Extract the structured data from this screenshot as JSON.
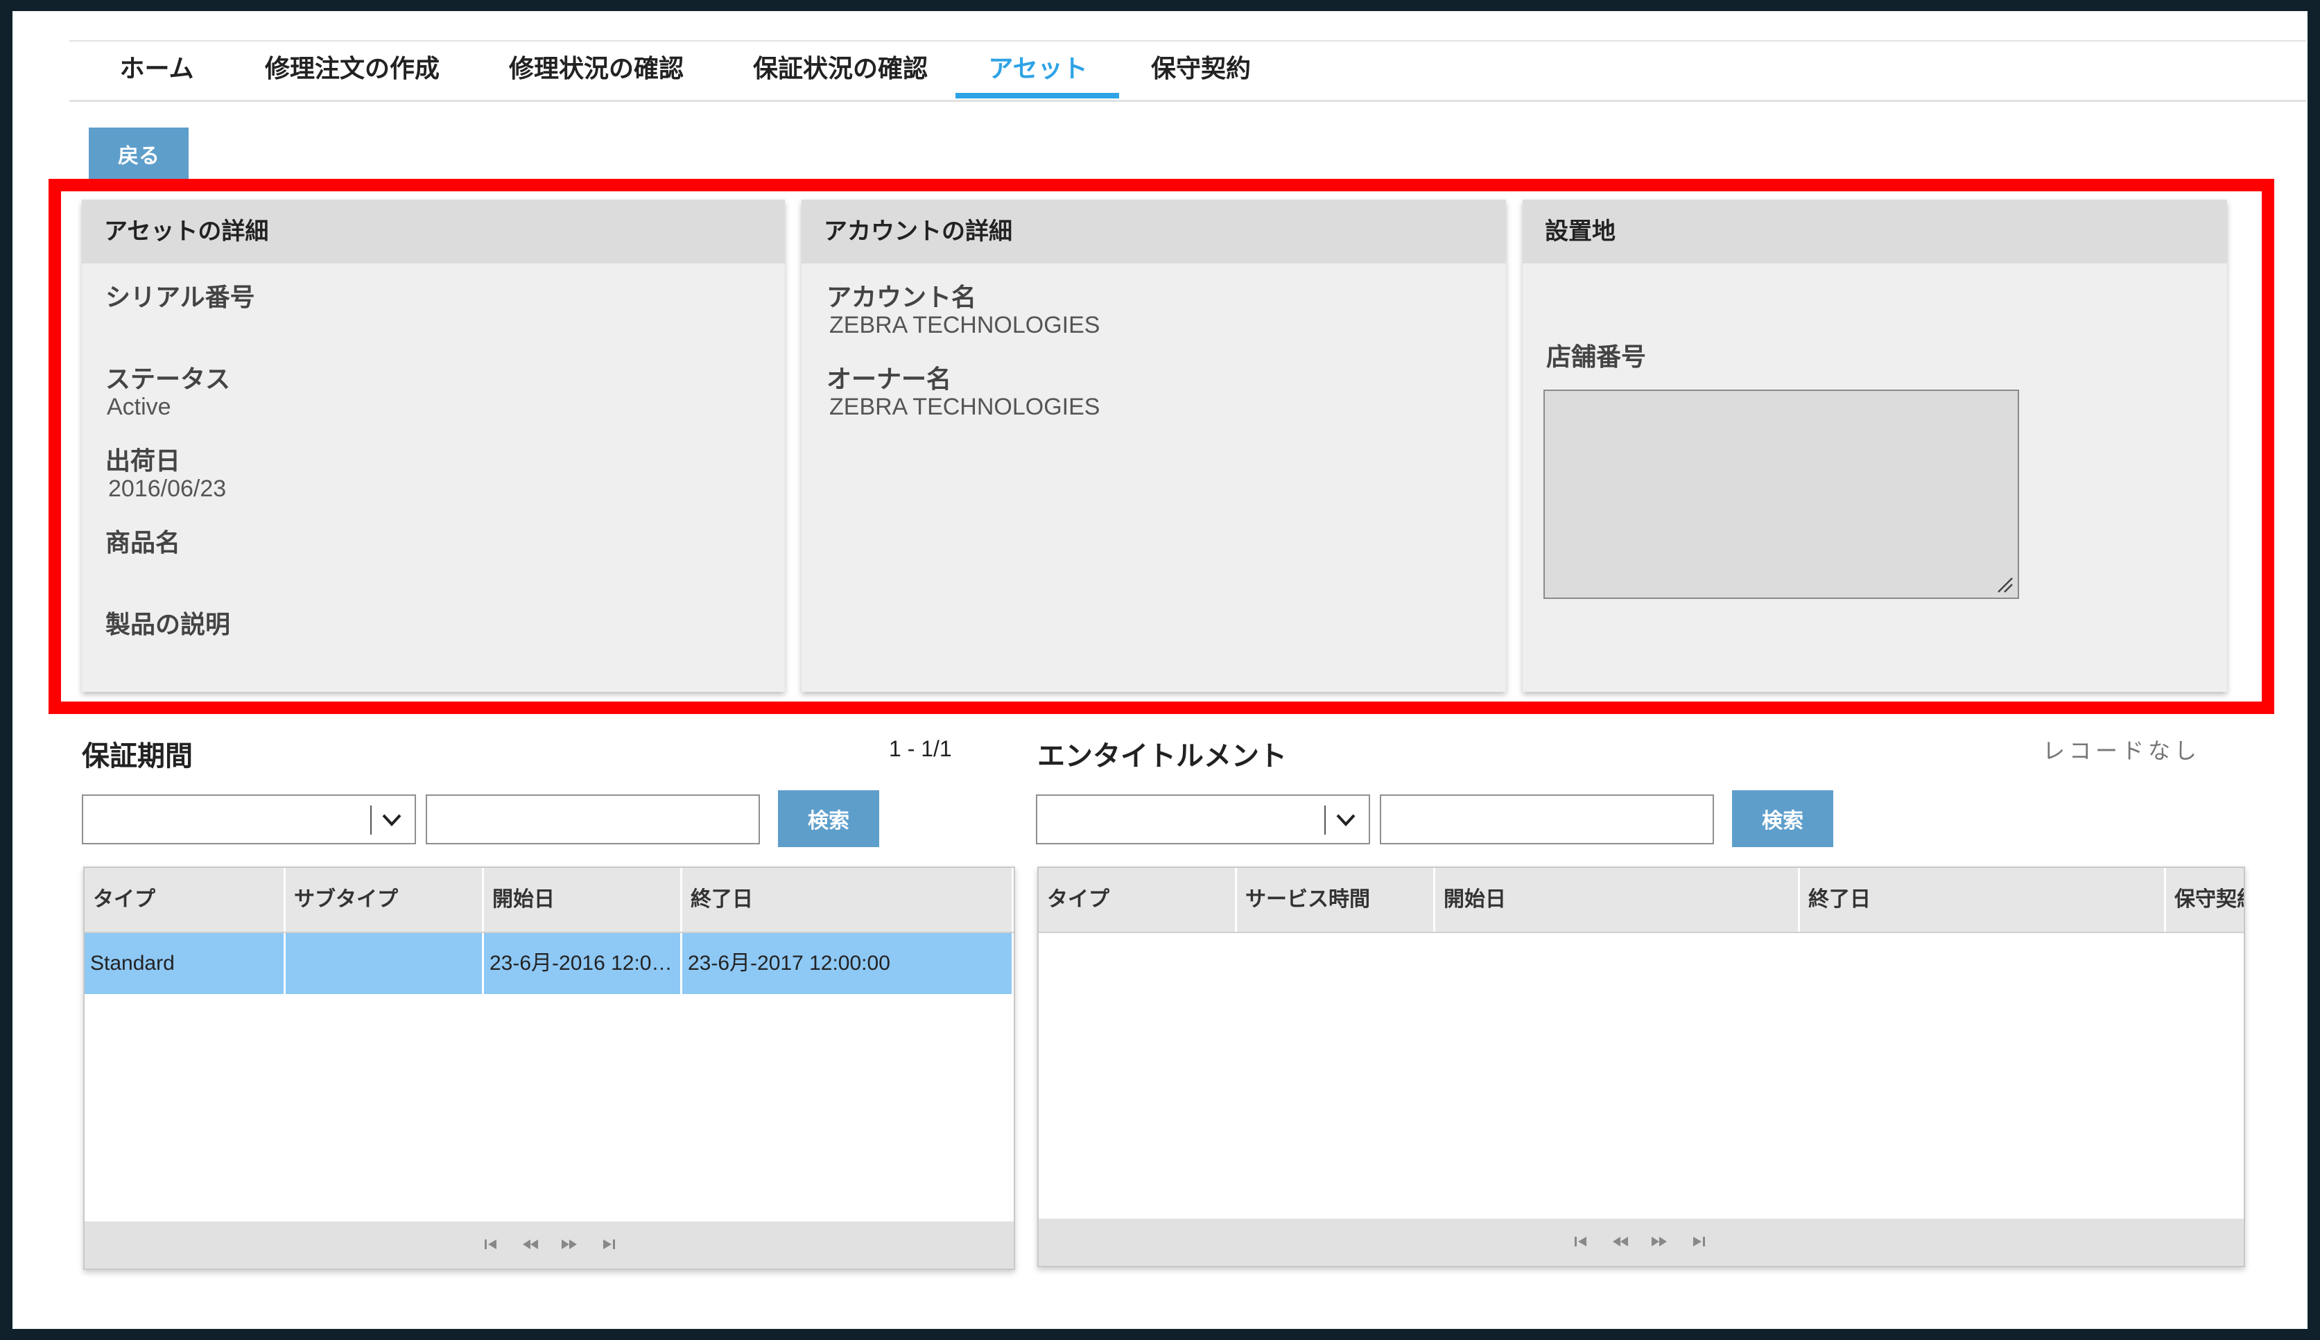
{
  "nav": {
    "items": [
      {
        "label": "ホーム"
      },
      {
        "label": "修理注文の作成"
      },
      {
        "label": "修理状況の確認"
      },
      {
        "label": "保証状況の確認"
      },
      {
        "label": "アセット"
      },
      {
        "label": "保守契約"
      }
    ],
    "active": "アセット"
  },
  "back_button": {
    "label": "戻る"
  },
  "asset_panel": {
    "title": "アセットの詳細",
    "serial_label": "シリアル番号",
    "serial_value": "",
    "status_label": "ステータス",
    "status_value": "Active",
    "ship_date_label": "出荷日",
    "ship_date_value": "2016/06/23",
    "product_name_label": "商品名",
    "product_desc_label": "製品の説明"
  },
  "account_panel": {
    "title": "アカウントの詳細",
    "account_name_label": "アカウント名",
    "account_name_value": "ZEBRA TECHNOLOGIES",
    "owner_name_label": "オーナー名",
    "owner_name_value": "ZEBRA TECHNOLOGIES"
  },
  "location_panel": {
    "title": "設置地",
    "store_number_label": "店舗番号"
  },
  "warranty": {
    "title": "保証期間",
    "count": "1 - 1/1",
    "search_label": "検索",
    "columns": [
      "タイプ",
      "サブタイプ",
      "開始日",
      "終了日"
    ],
    "rows": [
      {
        "type": "Standard",
        "subtype": "",
        "start": "23-6月-2016 12:0…",
        "end": "23-6月-2017 12:00:00"
      }
    ]
  },
  "entitlement": {
    "title": "エンタイトルメント",
    "no_records": "レコードなし",
    "search_label": "検索",
    "columns": [
      "タイプ",
      "サービス時間",
      "開始日",
      "終了日",
      "保守契約"
    ]
  },
  "colors": {
    "accent": "#2ea3e6",
    "button": "#5e9ecb",
    "highlight": "#ff0000",
    "selected_row": "#8ec8f5",
    "frame": "#10212b"
  }
}
